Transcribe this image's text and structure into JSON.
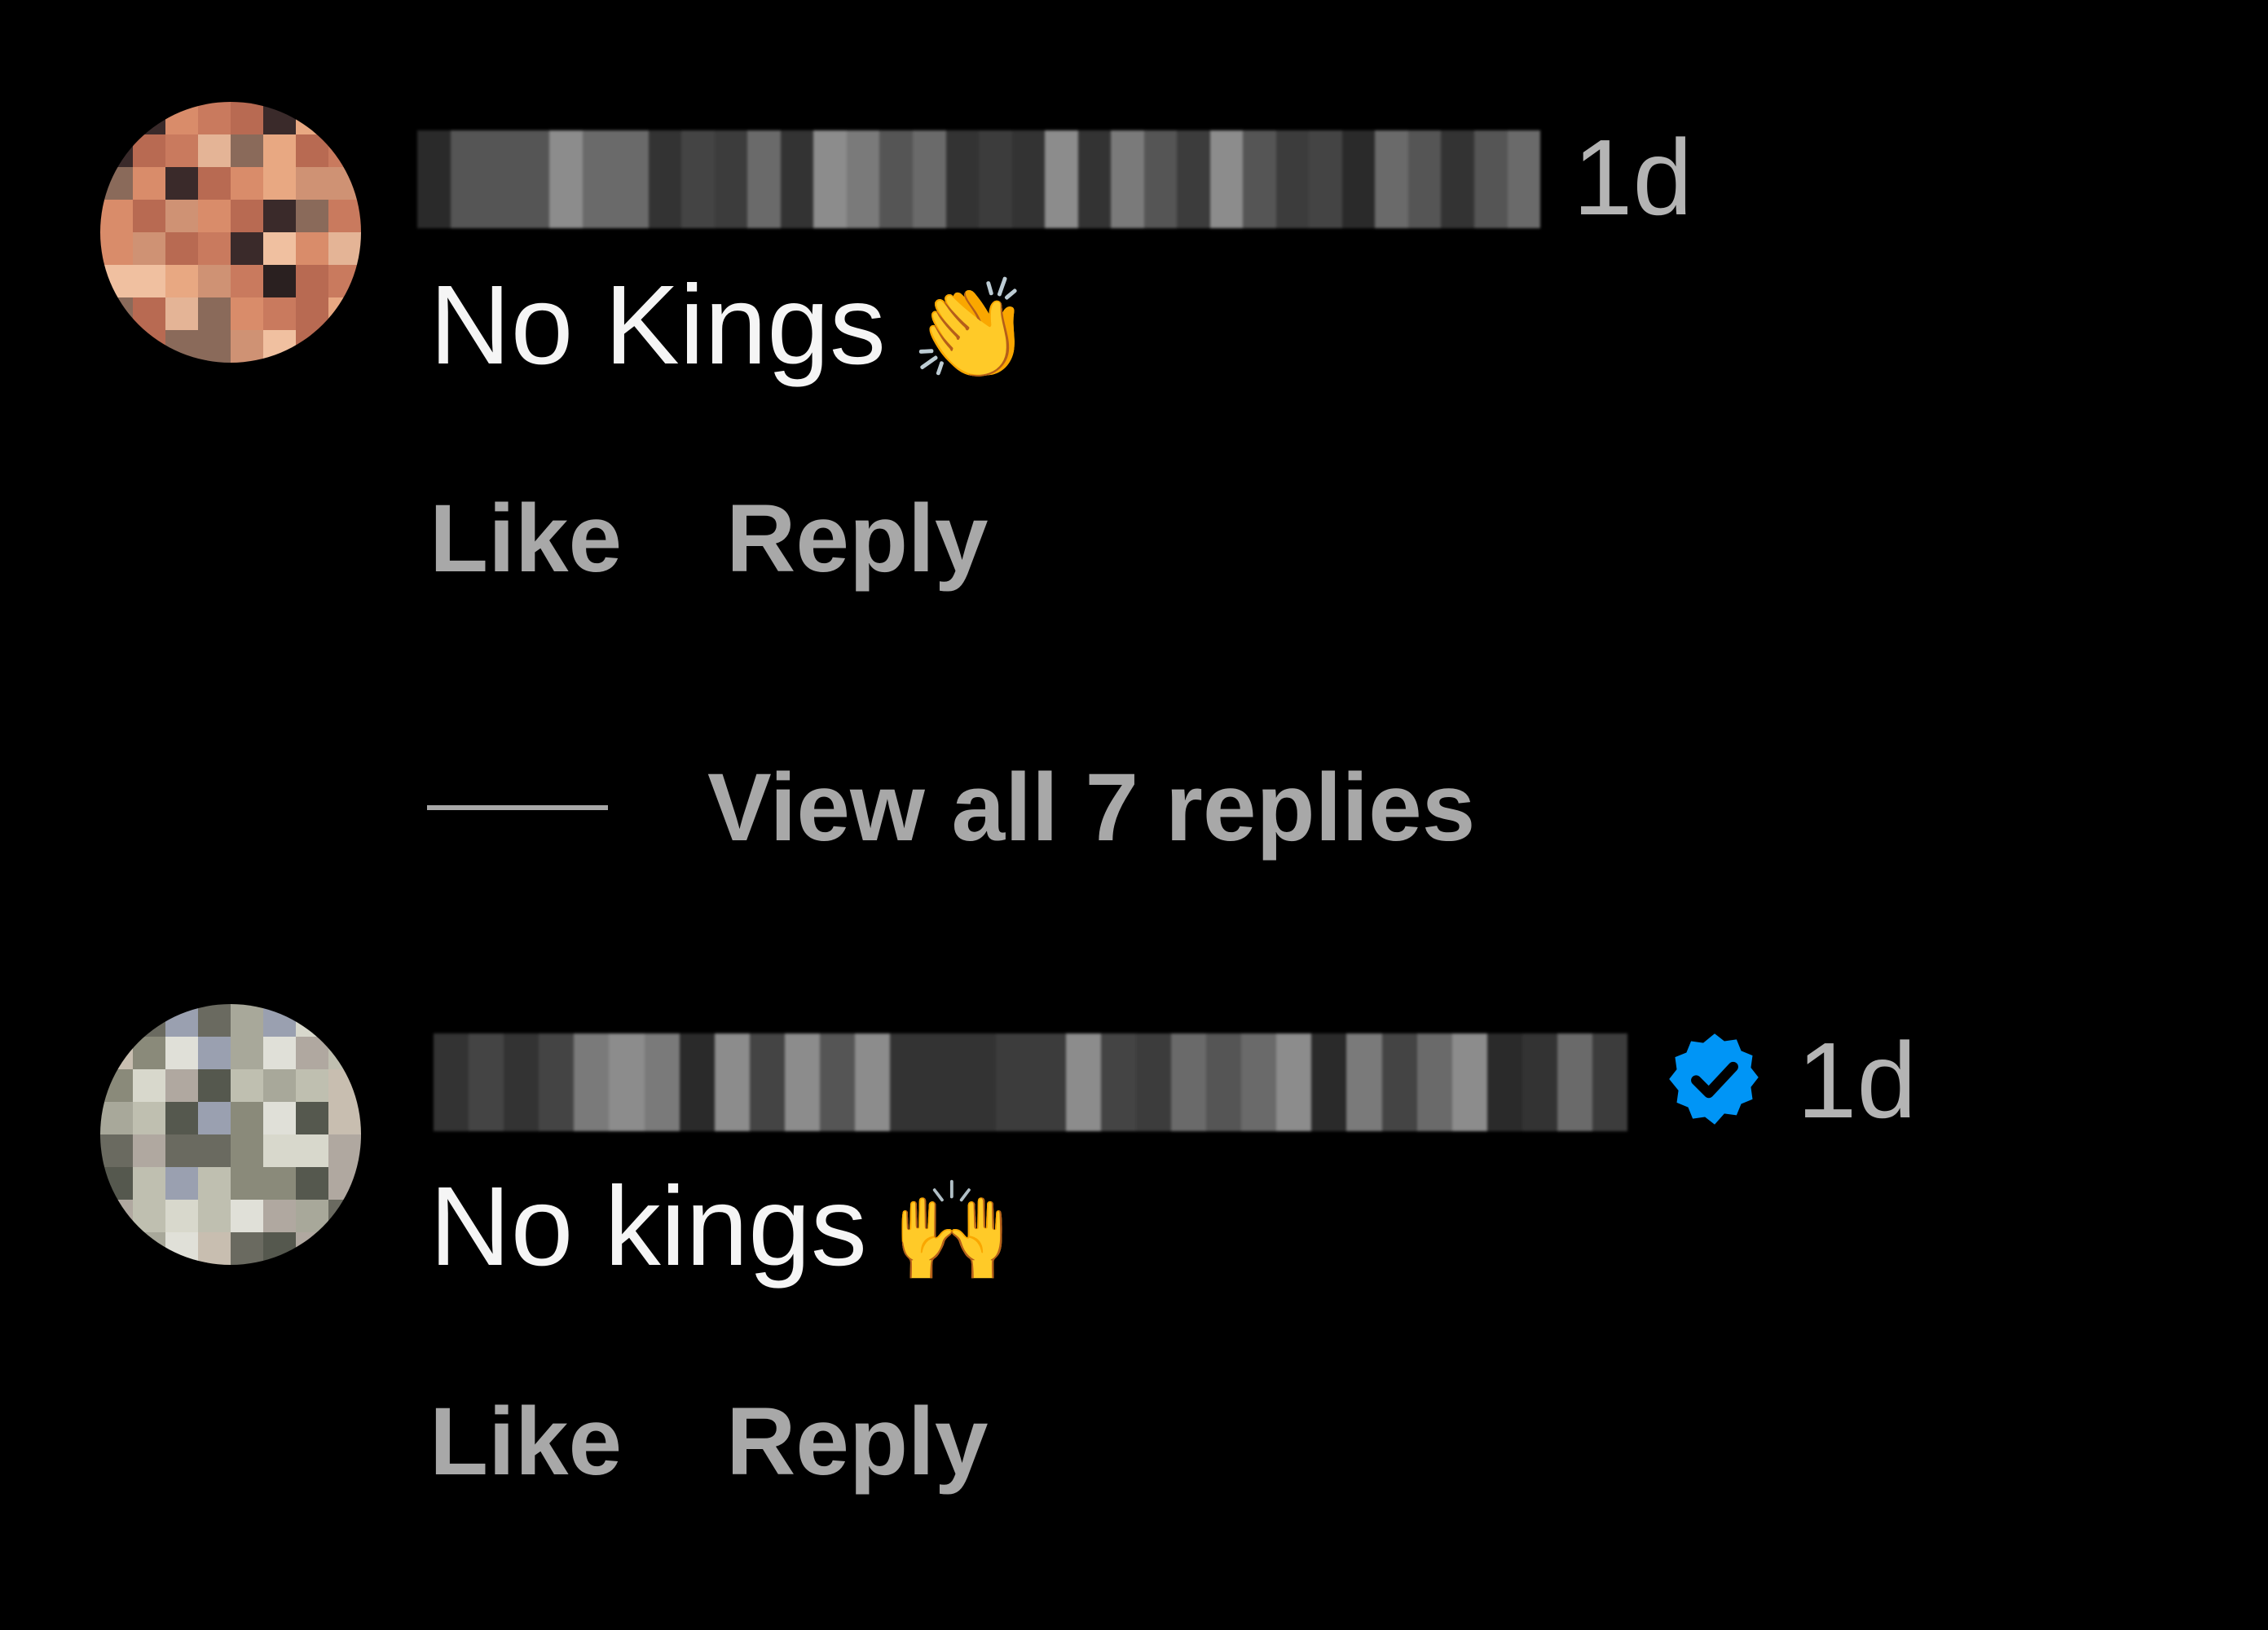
{
  "colors": {
    "background": "#000000",
    "primary_text": "#f5f5f5",
    "secondary_text": "#a8a8a8",
    "verified_blue": "#0095f6"
  },
  "comments": [
    {
      "time": "1d",
      "text": "No Kings",
      "emoji": "👏",
      "verified": false,
      "actions": {
        "like": "Like",
        "reply": "Reply"
      },
      "view_replies": "View all 7 replies"
    },
    {
      "time": "1d",
      "text": "No kings",
      "emoji": "🙌",
      "verified": true,
      "verified_icon": "verified-badge-icon",
      "actions": {
        "like": "Like",
        "reply": "Reply"
      }
    }
  ]
}
